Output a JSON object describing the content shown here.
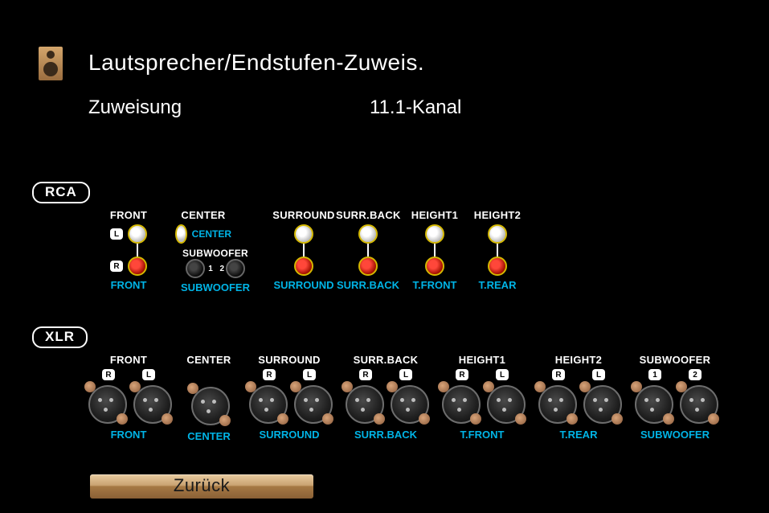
{
  "header": {
    "title": "Lautsprecher/Endstufen-Zuweis."
  },
  "assignment": {
    "label": "Zuweisung",
    "value": "11.1-Kanal"
  },
  "sections": {
    "rca": "RCA",
    "xlr": "XLR"
  },
  "badges": {
    "L": "L",
    "R": "R",
    "n1": "1",
    "n2": "2"
  },
  "rca": {
    "front": {
      "header": "FRONT",
      "assign": "FRONT"
    },
    "center": {
      "header": "CENTER",
      "assign": "CENTER"
    },
    "sub": {
      "header": "SUBWOOFER",
      "assign": "SUBWOOFER"
    },
    "surround": {
      "header": "SURROUND",
      "assign": "SURROUND"
    },
    "surrback": {
      "header": "SURR.BACK",
      "assign": "SURR.BACK"
    },
    "height1": {
      "header": "HEIGHT1",
      "assign": "T.FRONT"
    },
    "height2": {
      "header": "HEIGHT2",
      "assign": "T.REAR"
    }
  },
  "xlr": [
    {
      "header": "FRONT",
      "sub": [
        "R",
        "L"
      ],
      "assign": "FRONT"
    },
    {
      "header": "CENTER",
      "sub": [],
      "assign": "CENTER"
    },
    {
      "header": "SURROUND",
      "sub": [
        "R",
        "L"
      ],
      "assign": "SURROUND"
    },
    {
      "header": "SURR.BACK",
      "sub": [
        "R",
        "L"
      ],
      "assign": "SURR.BACK"
    },
    {
      "header": "HEIGHT1",
      "sub": [
        "R",
        "L"
      ],
      "assign": "T.FRONT"
    },
    {
      "header": "HEIGHT2",
      "sub": [
        "R",
        "L"
      ],
      "assign": "T.REAR"
    },
    {
      "header": "SUBWOOFER",
      "sub": [
        "1",
        "2"
      ],
      "assign": "SUBWOOFER"
    }
  ],
  "buttons": {
    "back": "Zurück"
  }
}
